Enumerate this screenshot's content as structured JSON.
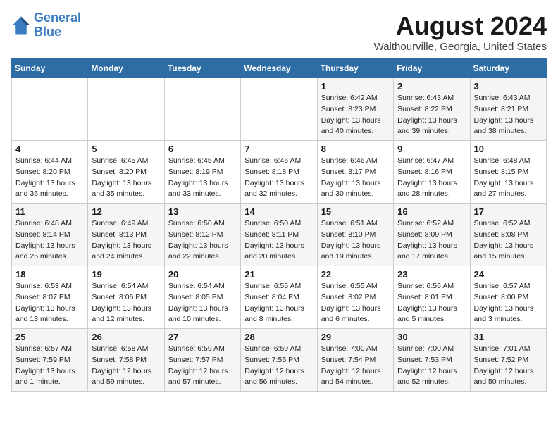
{
  "header": {
    "logo_line1": "General",
    "logo_line2": "Blue",
    "month_year": "August 2024",
    "location": "Walthourville, Georgia, United States"
  },
  "weekdays": [
    "Sunday",
    "Monday",
    "Tuesday",
    "Wednesday",
    "Thursday",
    "Friday",
    "Saturday"
  ],
  "weeks": [
    [
      {
        "day": "",
        "info": ""
      },
      {
        "day": "",
        "info": ""
      },
      {
        "day": "",
        "info": ""
      },
      {
        "day": "",
        "info": ""
      },
      {
        "day": "1",
        "info": "Sunrise: 6:42 AM\nSunset: 8:23 PM\nDaylight: 13 hours\nand 40 minutes."
      },
      {
        "day": "2",
        "info": "Sunrise: 6:43 AM\nSunset: 8:22 PM\nDaylight: 13 hours\nand 39 minutes."
      },
      {
        "day": "3",
        "info": "Sunrise: 6:43 AM\nSunset: 8:21 PM\nDaylight: 13 hours\nand 38 minutes."
      }
    ],
    [
      {
        "day": "4",
        "info": "Sunrise: 6:44 AM\nSunset: 8:20 PM\nDaylight: 13 hours\nand 36 minutes."
      },
      {
        "day": "5",
        "info": "Sunrise: 6:45 AM\nSunset: 8:20 PM\nDaylight: 13 hours\nand 35 minutes."
      },
      {
        "day": "6",
        "info": "Sunrise: 6:45 AM\nSunset: 8:19 PM\nDaylight: 13 hours\nand 33 minutes."
      },
      {
        "day": "7",
        "info": "Sunrise: 6:46 AM\nSunset: 8:18 PM\nDaylight: 13 hours\nand 32 minutes."
      },
      {
        "day": "8",
        "info": "Sunrise: 6:46 AM\nSunset: 8:17 PM\nDaylight: 13 hours\nand 30 minutes."
      },
      {
        "day": "9",
        "info": "Sunrise: 6:47 AM\nSunset: 8:16 PM\nDaylight: 13 hours\nand 28 minutes."
      },
      {
        "day": "10",
        "info": "Sunrise: 6:48 AM\nSunset: 8:15 PM\nDaylight: 13 hours\nand 27 minutes."
      }
    ],
    [
      {
        "day": "11",
        "info": "Sunrise: 6:48 AM\nSunset: 8:14 PM\nDaylight: 13 hours\nand 25 minutes."
      },
      {
        "day": "12",
        "info": "Sunrise: 6:49 AM\nSunset: 8:13 PM\nDaylight: 13 hours\nand 24 minutes."
      },
      {
        "day": "13",
        "info": "Sunrise: 6:50 AM\nSunset: 8:12 PM\nDaylight: 13 hours\nand 22 minutes."
      },
      {
        "day": "14",
        "info": "Sunrise: 6:50 AM\nSunset: 8:11 PM\nDaylight: 13 hours\nand 20 minutes."
      },
      {
        "day": "15",
        "info": "Sunrise: 6:51 AM\nSunset: 8:10 PM\nDaylight: 13 hours\nand 19 minutes."
      },
      {
        "day": "16",
        "info": "Sunrise: 6:52 AM\nSunset: 8:09 PM\nDaylight: 13 hours\nand 17 minutes."
      },
      {
        "day": "17",
        "info": "Sunrise: 6:52 AM\nSunset: 8:08 PM\nDaylight: 13 hours\nand 15 minutes."
      }
    ],
    [
      {
        "day": "18",
        "info": "Sunrise: 6:53 AM\nSunset: 8:07 PM\nDaylight: 13 hours\nand 13 minutes."
      },
      {
        "day": "19",
        "info": "Sunrise: 6:54 AM\nSunset: 8:06 PM\nDaylight: 13 hours\nand 12 minutes."
      },
      {
        "day": "20",
        "info": "Sunrise: 6:54 AM\nSunset: 8:05 PM\nDaylight: 13 hours\nand 10 minutes."
      },
      {
        "day": "21",
        "info": "Sunrise: 6:55 AM\nSunset: 8:04 PM\nDaylight: 13 hours\nand 8 minutes."
      },
      {
        "day": "22",
        "info": "Sunrise: 6:55 AM\nSunset: 8:02 PM\nDaylight: 13 hours\nand 6 minutes."
      },
      {
        "day": "23",
        "info": "Sunrise: 6:56 AM\nSunset: 8:01 PM\nDaylight: 13 hours\nand 5 minutes."
      },
      {
        "day": "24",
        "info": "Sunrise: 6:57 AM\nSunset: 8:00 PM\nDaylight: 13 hours\nand 3 minutes."
      }
    ],
    [
      {
        "day": "25",
        "info": "Sunrise: 6:57 AM\nSunset: 7:59 PM\nDaylight: 13 hours\nand 1 minute."
      },
      {
        "day": "26",
        "info": "Sunrise: 6:58 AM\nSunset: 7:58 PM\nDaylight: 12 hours\nand 59 minutes."
      },
      {
        "day": "27",
        "info": "Sunrise: 6:59 AM\nSunset: 7:57 PM\nDaylight: 12 hours\nand 57 minutes."
      },
      {
        "day": "28",
        "info": "Sunrise: 6:59 AM\nSunset: 7:55 PM\nDaylight: 12 hours\nand 56 minutes."
      },
      {
        "day": "29",
        "info": "Sunrise: 7:00 AM\nSunset: 7:54 PM\nDaylight: 12 hours\nand 54 minutes."
      },
      {
        "day": "30",
        "info": "Sunrise: 7:00 AM\nSunset: 7:53 PM\nDaylight: 12 hours\nand 52 minutes."
      },
      {
        "day": "31",
        "info": "Sunrise: 7:01 AM\nSunset: 7:52 PM\nDaylight: 12 hours\nand 50 minutes."
      }
    ]
  ]
}
